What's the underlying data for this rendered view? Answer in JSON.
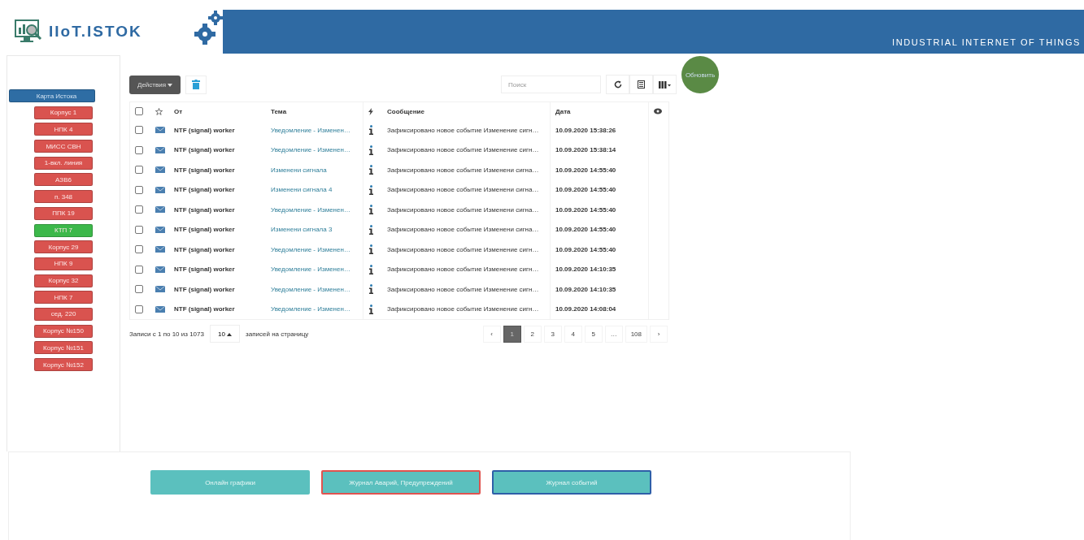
{
  "header": {
    "brand": "IIoT.ISTOK",
    "tagline": "INDUSTRIAL INTERNET OF THINGS"
  },
  "sidebar": {
    "items": [
      {
        "label": "Карта Истока",
        "kind": "main",
        "color": "#2e6da4"
      },
      {
        "label": "Корпус 1",
        "kind": "site",
        "color": "#d9534f"
      },
      {
        "label": "НПК 4",
        "kind": "site",
        "color": "#d9534f"
      },
      {
        "label": "МИСС СВН",
        "kind": "site",
        "color": "#d9534f"
      },
      {
        "label": "1-вкл. линия",
        "kind": "site",
        "color": "#d9534f"
      },
      {
        "label": "АЗВ6",
        "kind": "site",
        "color": "#d9534f"
      },
      {
        "label": "п. 348",
        "kind": "site",
        "color": "#d9534f"
      },
      {
        "label": "ППК 19",
        "kind": "site",
        "color": "#d9534f"
      },
      {
        "label": "КТП 7",
        "kind": "site",
        "color": "#3cb84a"
      },
      {
        "label": "Корпус 29",
        "kind": "site",
        "color": "#d9534f"
      },
      {
        "label": "НПК 9",
        "kind": "site",
        "color": "#d9534f"
      },
      {
        "label": "Корпус 32",
        "kind": "site",
        "color": "#d9534f"
      },
      {
        "label": "НПК 7",
        "kind": "site",
        "color": "#d9534f"
      },
      {
        "label": "сед. 220",
        "kind": "site",
        "color": "#d9534f"
      },
      {
        "label": "Корпус №150",
        "kind": "site",
        "color": "#d9534f"
      },
      {
        "label": "Корпус №151",
        "kind": "site",
        "color": "#d9534f"
      },
      {
        "label": "Корпус №152",
        "kind": "site",
        "color": "#d9534f"
      }
    ]
  },
  "toolbar": {
    "actions": "Действия",
    "search": {
      "placeholder": "Поиск"
    },
    "refresh_button": "Обновить"
  },
  "table": {
    "select_all": {
      "checked": false
    },
    "columns": [
      "От",
      "Тема",
      "Сообщение",
      "Дата"
    ],
    "rows": [
      {
        "checked": false,
        "from": "NTF (signal) worker",
        "topic": "Уведомление - Изменен…",
        "message": "Зафиксировано новое событие Изменение сигн…",
        "date": "10.09.2020 15:38:26"
      },
      {
        "checked": false,
        "from": "NTF (signal) worker",
        "topic": "Уведомление - Изменен…",
        "message": "Зафиксировано новое событие Изменение сигн…",
        "date": "10.09.2020 15:38:14"
      },
      {
        "checked": false,
        "from": "NTF (signal) worker",
        "topic": "Изменени сигнала",
        "message": "Зафиксировано новое событие Изменени сигна…",
        "date": "10.09.2020 14:55:40"
      },
      {
        "checked": false,
        "from": "NTF (signal) worker",
        "topic": "Изменени сигнала 4",
        "message": "Зафиксировано новое событие Изменени сигна…",
        "date": "10.09.2020 14:55:40"
      },
      {
        "checked": false,
        "from": "NTF (signal) worker",
        "topic": "Уведомление - Изменен…",
        "message": "Зафиксировано новое событие Изменени сигна…",
        "date": "10.09.2020 14:55:40"
      },
      {
        "checked": false,
        "from": "NTF (signal) worker",
        "topic": "Изменени сигнала 3",
        "message": "Зафиксировано новое событие Изменени сигна…",
        "date": "10.09.2020 14:55:40"
      },
      {
        "checked": false,
        "from": "NTF (signal) worker",
        "topic": "Уведомление - Изменен…",
        "message": "Зафиксировано новое событие Изменение сигн…",
        "date": "10.09.2020 14:55:40"
      },
      {
        "checked": false,
        "from": "NTF (signal) worker",
        "topic": "Уведомление - Изменен…",
        "message": "Зафиксировано новое событие Изменение сигн…",
        "date": "10.09.2020 14:10:35"
      },
      {
        "checked": false,
        "from": "NTF (signal) worker",
        "topic": "Уведомление - Изменен…",
        "message": "Зафиксировано новое событие Изменение сигн…",
        "date": "10.09.2020 14:10:35"
      },
      {
        "checked": false,
        "from": "NTF (signal) worker",
        "topic": "Уведомление - Изменен…",
        "message": "Зафиксировано новое событие Изменение сигн…",
        "date": "10.09.2020 14:08:04"
      }
    ]
  },
  "footer": {
    "summary": "Записи с 1 по 10 из 1073",
    "page_size": "10",
    "page_size_label": "записей на страницу",
    "pagination": {
      "prev": "‹",
      "next": "›",
      "pages": [
        {
          "label": "1",
          "selected": true
        },
        {
          "label": "2",
          "selected": false
        },
        {
          "label": "3",
          "selected": false
        },
        {
          "label": "4",
          "selected": false
        },
        {
          "label": "5",
          "selected": false
        },
        {
          "label": "…",
          "selected": false
        },
        {
          "label": "108",
          "selected": false
        }
      ]
    }
  },
  "bottom_buttons": [
    {
      "label": "Онлайн графики",
      "color": "#5bc0be"
    },
    {
      "label": "Журнал Аварий, Предупреждений",
      "color": "#e0534f"
    },
    {
      "label": "Журнал событий",
      "color": "#2e5fa8"
    }
  ]
}
